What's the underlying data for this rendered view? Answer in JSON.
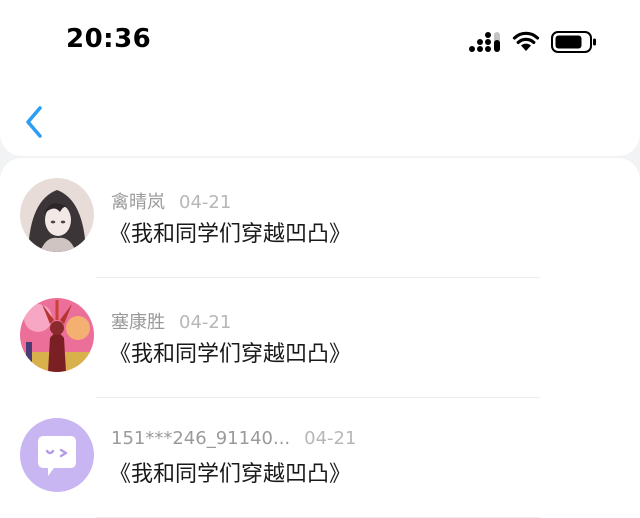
{
  "status_bar": {
    "time": "20:36"
  },
  "nav": {
    "back_icon": "chevron-left-icon",
    "accent_color": "#2a9df4"
  },
  "comments": [
    {
      "username": "禽晴岚",
      "date": "04-21",
      "text": "《我和同学们穿越凹凸》",
      "avatar": "anime-girl-avatar"
    },
    {
      "username": "塞康胜",
      "date": "04-21",
      "text": "《我和同学们穿越凹凸》",
      "avatar": "warrior-character-avatar"
    },
    {
      "username": "151***246_91140...",
      "date": "04-21",
      "text": "《我和同学们穿越凹凸》",
      "avatar": "chat-bubble-default-avatar"
    }
  ]
}
